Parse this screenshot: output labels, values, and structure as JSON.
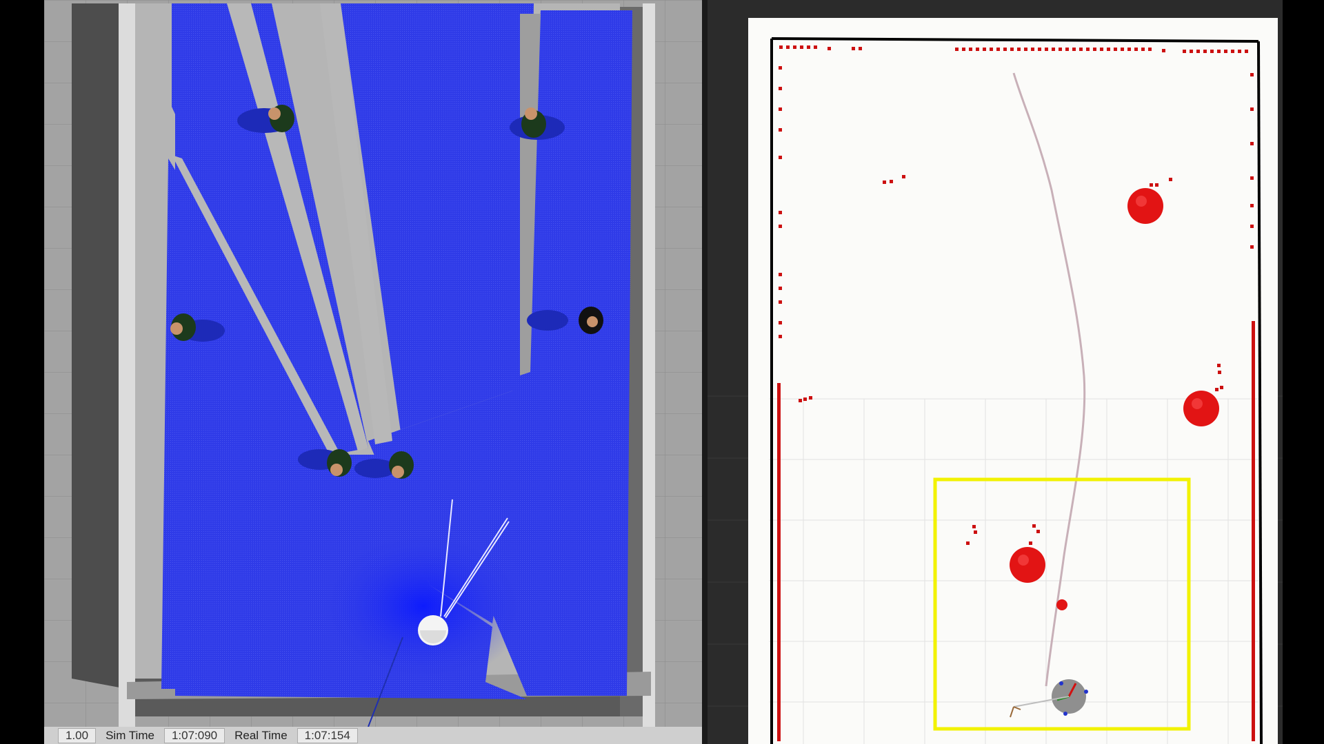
{
  "simulator": {
    "status_bar": {
      "real_time_factor_label": "",
      "real_time_factor_value": "1.00",
      "sim_time_label": "Sim Time",
      "sim_time_value": "1:07:090",
      "real_time_label": "Real Time",
      "real_time_value": "1:07:154"
    },
    "colors": {
      "laser": "#2f3be8",
      "floor": "#9c9c9c",
      "wall_top": "#d8d8d8",
      "wall_shadow": "#555555"
    }
  },
  "rviz": {
    "colors": {
      "map_background": "#fbfbf9",
      "laser_points": "#cc1010",
      "obstacle_marker": "#e21414",
      "goal_region": "#f2f200",
      "path": "#c8b0b8",
      "robot": "#8f8f8f"
    }
  }
}
